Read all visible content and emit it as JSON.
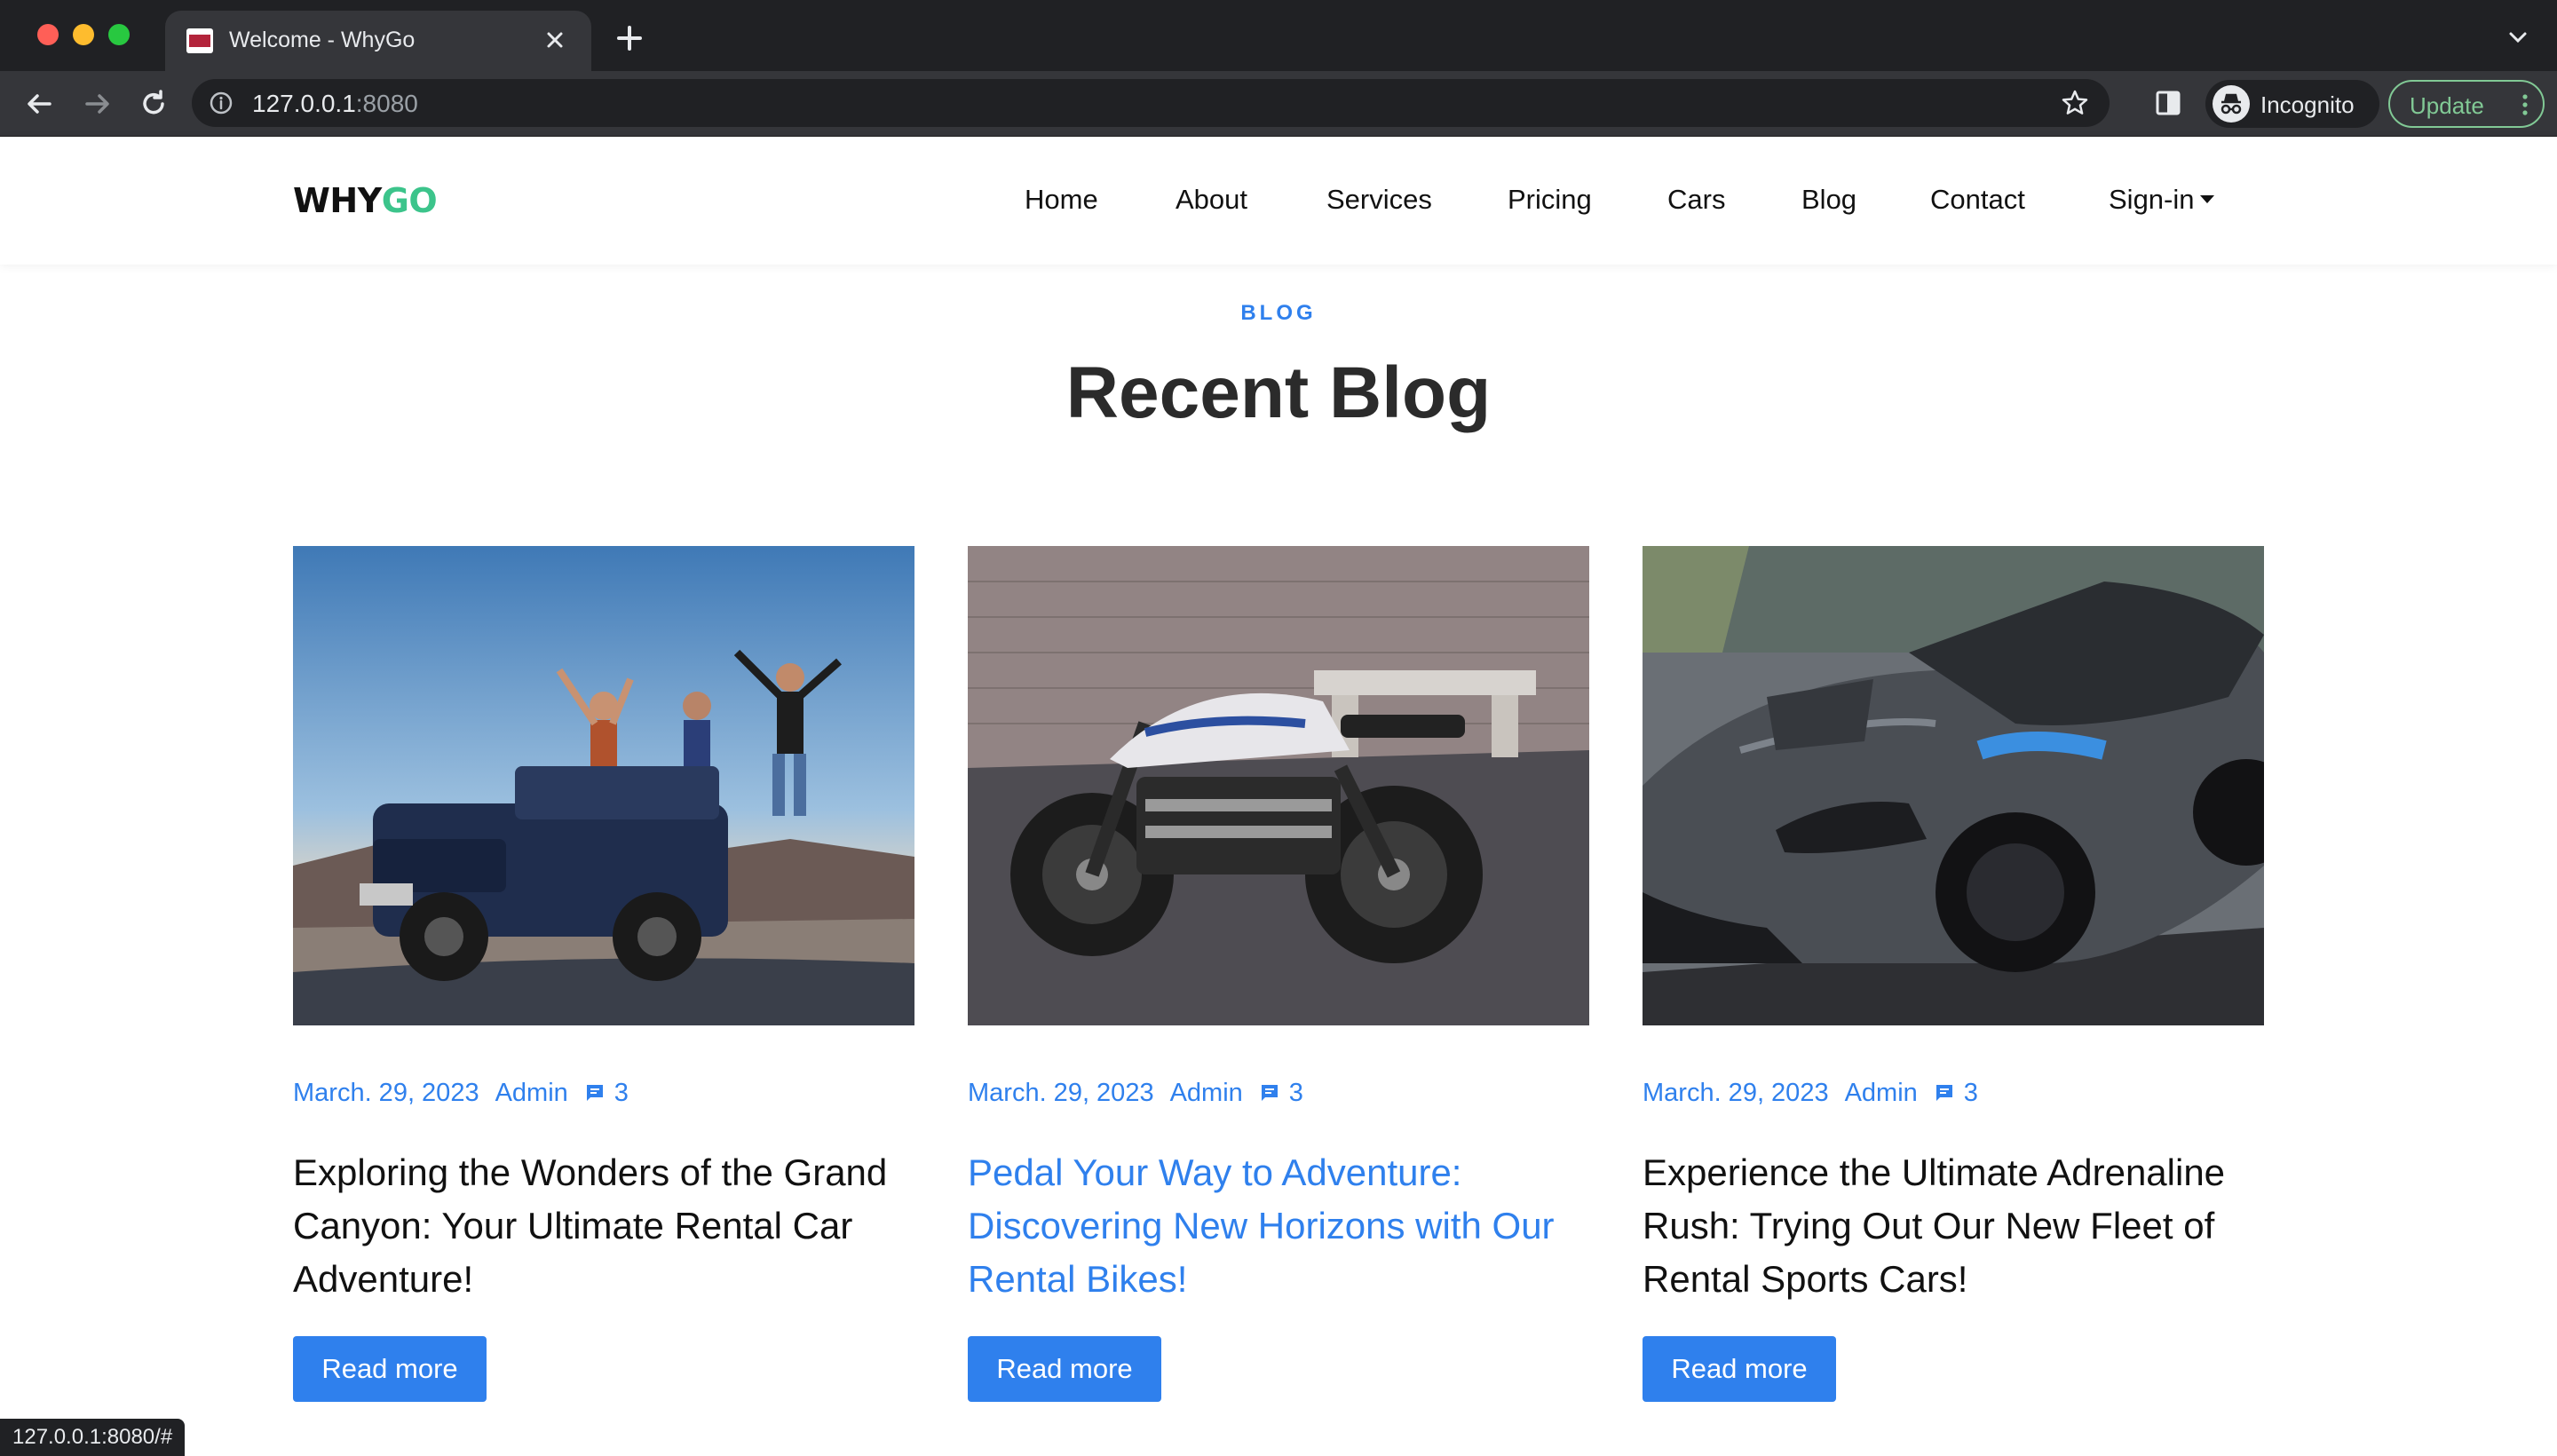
{
  "browser": {
    "tab_title": "Welcome - WhyGo",
    "url_host": "127.0.0.1",
    "url_port": ":8080",
    "profile_label": "Incognito",
    "update_label": "Update",
    "status_url": "127.0.0.1:8080/#"
  },
  "site": {
    "logo_main": "WHY",
    "logo_accent": "GO",
    "nav": [
      "Home",
      "About",
      "Services",
      "Pricing",
      "Cars",
      "Blog",
      "Contact",
      "Sign-in"
    ],
    "accent_color": "#2f80ed",
    "logo_accent_color": "#3cc48b"
  },
  "blog": {
    "eyebrow": "BLOG",
    "title": "Recent Blog",
    "posts": [
      {
        "date": "March. 29, 2023",
        "author": "Admin",
        "comments": "3",
        "title": "Exploring the Wonders of the Grand Canyon: Your Ultimate Rental Car Adventure!",
        "button": "Read more",
        "image": "jeep-with-friends-photo"
      },
      {
        "date": "March. 29, 2023",
        "author": "Admin",
        "comments": "3",
        "title": "Pedal Your Way to Adventure: Discovering New Horizons with Our Rental Bikes!",
        "button": "Read more",
        "image": "cafe-racer-motorcycle-photo"
      },
      {
        "date": "March. 29, 2023",
        "author": "Admin",
        "comments": "3",
        "title": "Experience the Ultimate Adrenaline Rush: Trying Out Our New Fleet of Rental Sports Cars!",
        "button": "Read more",
        "image": "grey-sports-car-photo"
      }
    ]
  }
}
